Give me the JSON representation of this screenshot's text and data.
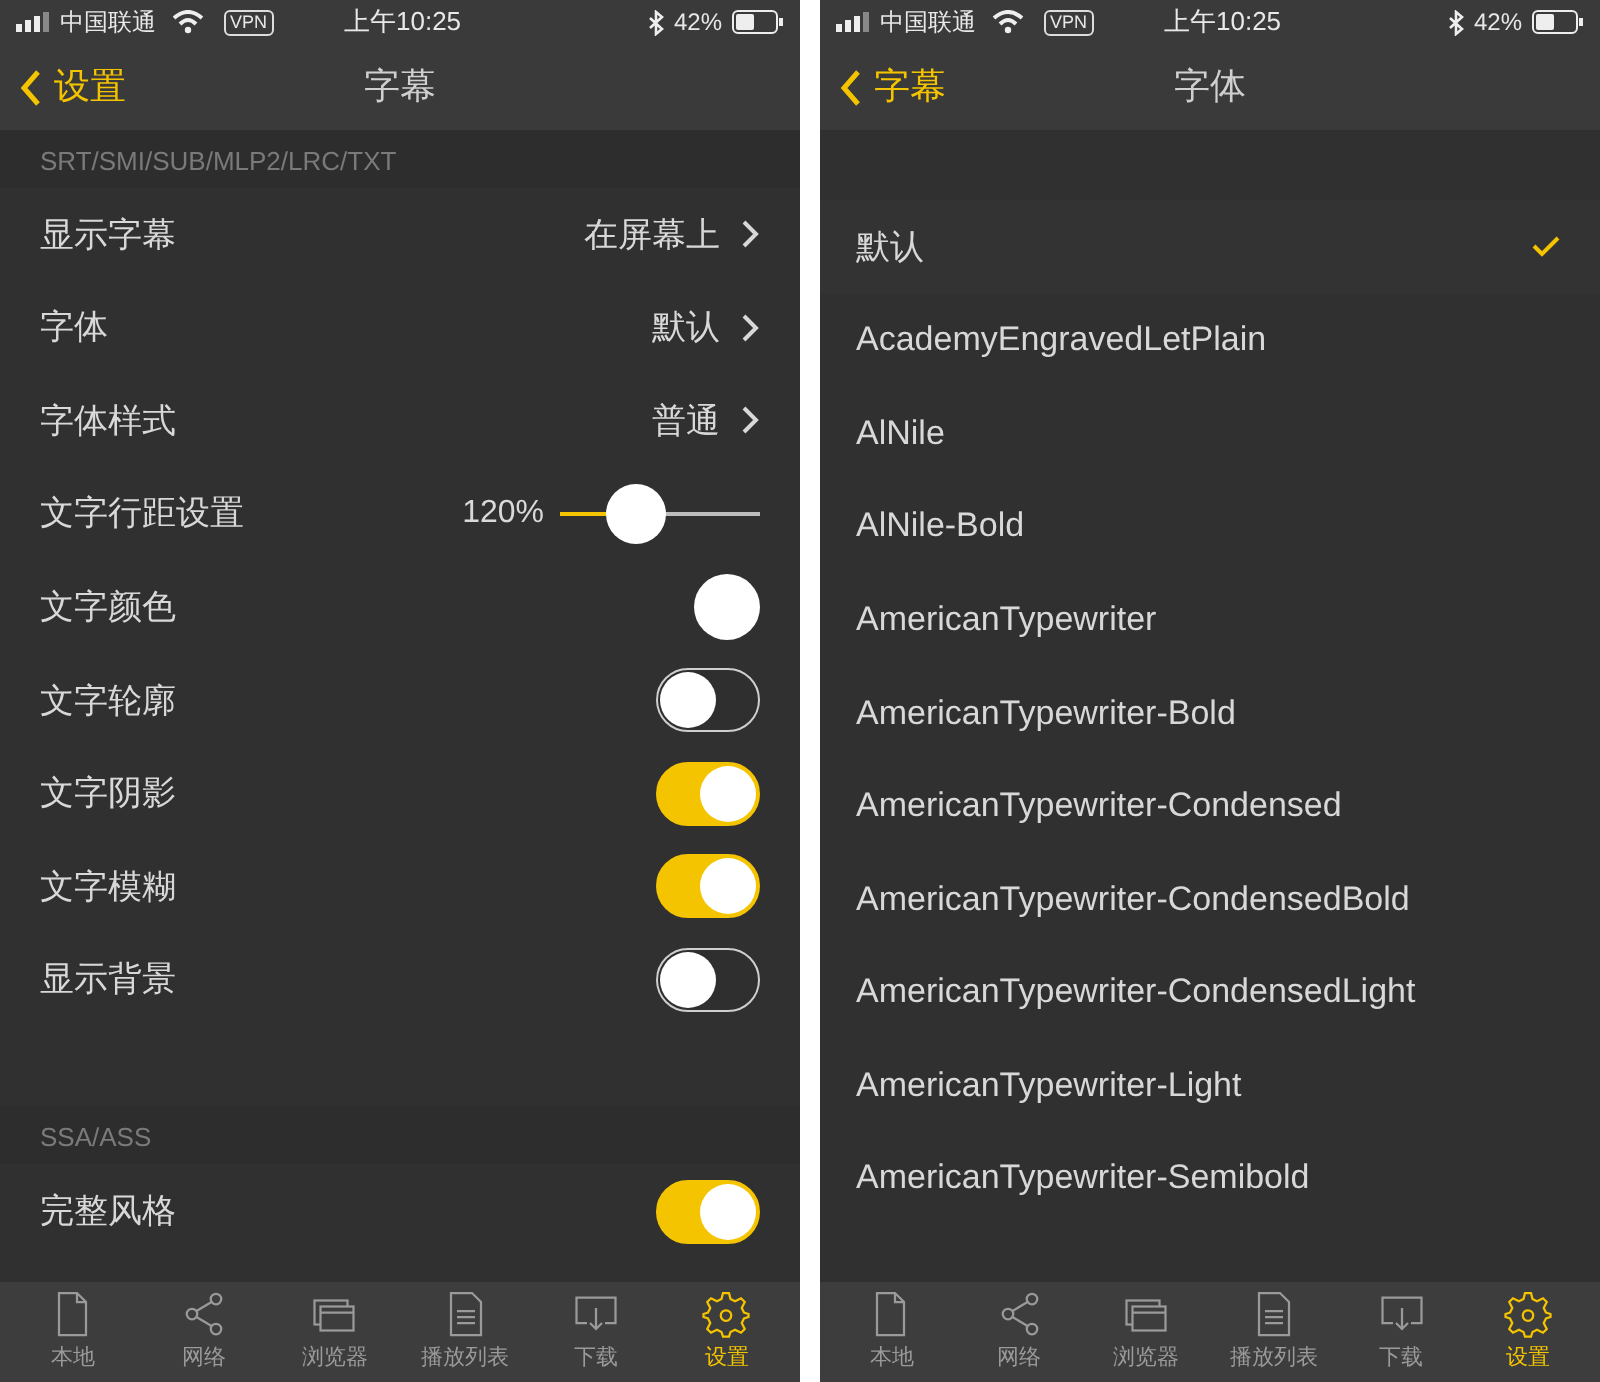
{
  "screens": [
    {
      "status_bar": {
        "carrier": "中国联通",
        "vpn": "VPN",
        "time": "上午10:25",
        "battery": "42%"
      },
      "nav": {
        "back": "设置",
        "title": "字幕"
      },
      "sections": [
        {
          "header": "SRT/SMI/SUB/MLP2/LRC/TXT",
          "rows": [
            {
              "kind": "value",
              "label": "显示字幕",
              "value": "在屏幕上"
            },
            {
              "kind": "value",
              "label": "字体",
              "value": "默认"
            },
            {
              "kind": "value",
              "label": "字体样式",
              "value": "普通"
            },
            {
              "kind": "slider",
              "label": "文字行距设置",
              "reading": "120%",
              "level": 0.38
            },
            {
              "kind": "color",
              "label": "文字颜色",
              "color": "#ffffff"
            },
            {
              "kind": "switch",
              "label": "文字轮廓",
              "on": false
            },
            {
              "kind": "switch",
              "label": "文字阴影",
              "on": true
            },
            {
              "kind": "switch",
              "label": "文字模糊",
              "on": true
            },
            {
              "kind": "switch",
              "label": "显示背景",
              "on": false
            }
          ]
        },
        {
          "header": "SSA/ASS",
          "rows": [
            {
              "kind": "switch",
              "label": "完整风格",
              "on": true
            }
          ]
        }
      ],
      "tab_bar": [
        {
          "label": "本地",
          "selected": false
        },
        {
          "label": "网络",
          "selected": false
        },
        {
          "label": "浏览器",
          "selected": false
        },
        {
          "label": "播放列表",
          "selected": false
        },
        {
          "label": "下载",
          "selected": false
        },
        {
          "label": "设置",
          "selected": true
        }
      ]
    },
    {
      "status_bar": {
        "carrier": "中国联通",
        "vpn": "VPN",
        "time": "上午10:25",
        "battery": "42%"
      },
      "nav": {
        "back": "字幕",
        "title": "字体"
      },
      "fonts": [
        {
          "name": "默认",
          "selected": true
        },
        {
          "name": "AcademyEngravedLetPlain",
          "selected": false
        },
        {
          "name": "AlNile",
          "selected": false
        },
        {
          "name": "AlNile-Bold",
          "selected": false
        },
        {
          "name": "AmericanTypewriter",
          "selected": false
        },
        {
          "name": "AmericanTypewriter-Bold",
          "selected": false
        },
        {
          "name": "AmericanTypewriter-Condensed",
          "selected": false
        },
        {
          "name": "AmericanTypewriter-CondensedBold",
          "selected": false
        },
        {
          "name": "AmericanTypewriter-CondensedLight",
          "selected": false
        },
        {
          "name": "AmericanTypewriter-Light",
          "selected": false
        },
        {
          "name": "AmericanTypewriter-Semibold",
          "selected": false
        }
      ],
      "tab_bar": [
        {
          "label": "本地",
          "selected": false
        },
        {
          "label": "网络",
          "selected": false
        },
        {
          "label": "浏览器",
          "selected": false
        },
        {
          "label": "播放列表",
          "selected": false
        },
        {
          "label": "下载",
          "selected": false
        },
        {
          "label": "设置",
          "selected": true
        }
      ]
    }
  ]
}
